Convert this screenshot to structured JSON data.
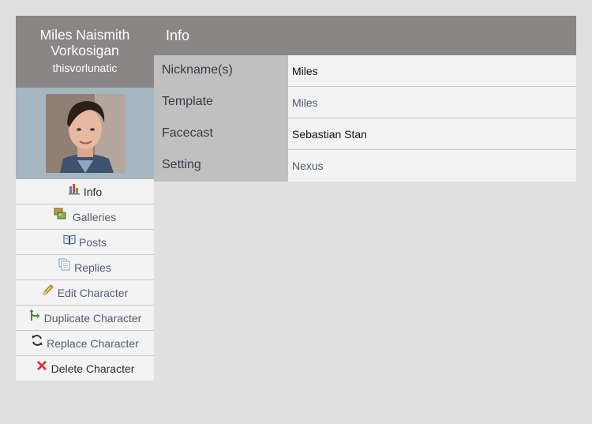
{
  "character": {
    "name": "Miles Naismith Vorkosigan",
    "user": "thisvorlunatic",
    "avatar_alt": "Sebastian Stan"
  },
  "sidebar": {
    "items": [
      {
        "label": "Info",
        "icon": "info-chart-icon"
      },
      {
        "label": "Galleries",
        "icon": "galleries-icon"
      },
      {
        "label": "Posts",
        "icon": "book-icon"
      },
      {
        "label": "Replies",
        "icon": "replies-icon"
      },
      {
        "label": "Edit Character",
        "icon": "pencil-icon"
      },
      {
        "label": "Duplicate Character",
        "icon": "duplicate-arrow-icon"
      },
      {
        "label": "Replace Character",
        "icon": "refresh-icon"
      },
      {
        "label": "Delete Character",
        "icon": "delete-x-icon"
      }
    ]
  },
  "main": {
    "title": "Info",
    "rows": [
      {
        "label": "Nickname(s)",
        "value": "Miles"
      },
      {
        "label": "Template",
        "value": "Miles"
      },
      {
        "label": "Facecast",
        "value": "Sebastian Stan"
      },
      {
        "label": "Setting",
        "value": "Nexus"
      }
    ]
  },
  "colors": {
    "page_bg": "#e0e0e0",
    "header_bg": "#8b8686",
    "avatar_bg": "#a4b6bf",
    "label_bg": "#c0c0c0",
    "value_bg": "#f3f3f3",
    "link": "#4e5d73"
  }
}
